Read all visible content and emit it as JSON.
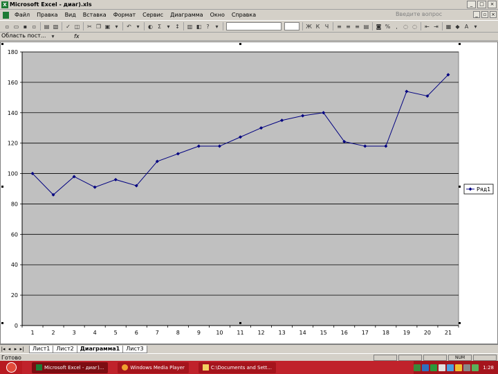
{
  "window": {
    "title": "Microsoft Excel - диаг).xls",
    "app_icon_letter": "X"
  },
  "menu": {
    "items": [
      "Файл",
      "Правка",
      "Вид",
      "Вставка",
      "Формат",
      "Сервис",
      "Диаграмма",
      "Окно",
      "Справка"
    ],
    "ask_placeholder": "Введите вопрос"
  },
  "formula_bar": {
    "name_box": "Область пост...",
    "fx_label": "fx"
  },
  "chart_data": {
    "type": "line",
    "x": [
      1,
      2,
      3,
      4,
      5,
      6,
      7,
      8,
      9,
      10,
      11,
      12,
      13,
      14,
      15,
      16,
      17,
      18,
      19,
      20,
      21
    ],
    "series": [
      {
        "name": "Ряд1",
        "values": [
          100,
          86,
          98,
          91,
          96,
          92,
          108,
          113,
          118,
          118,
          124,
          130,
          135,
          138,
          140,
          121,
          118,
          118,
          154,
          151,
          165
        ],
        "color": "#000080"
      }
    ],
    "ylim": [
      0,
      180
    ],
    "yticks": [
      0,
      20,
      40,
      60,
      80,
      100,
      120,
      140,
      160,
      180
    ],
    "grid": true,
    "plot_bg": "#c0c0c0",
    "legend_position": "right"
  },
  "sheet_tabs": {
    "items": [
      "Лист1",
      "Лист2",
      "Диаграмма1",
      "Лист3"
    ],
    "active": "Диаграмма1"
  },
  "status": {
    "text": "Готово",
    "num_indicator": "NUM"
  },
  "taskbar": {
    "tasks": [
      "Microsoft Excel - диаг)...",
      "Windows Media Player",
      "C:\\Documents and Sett..."
    ],
    "clock": "1:28"
  }
}
